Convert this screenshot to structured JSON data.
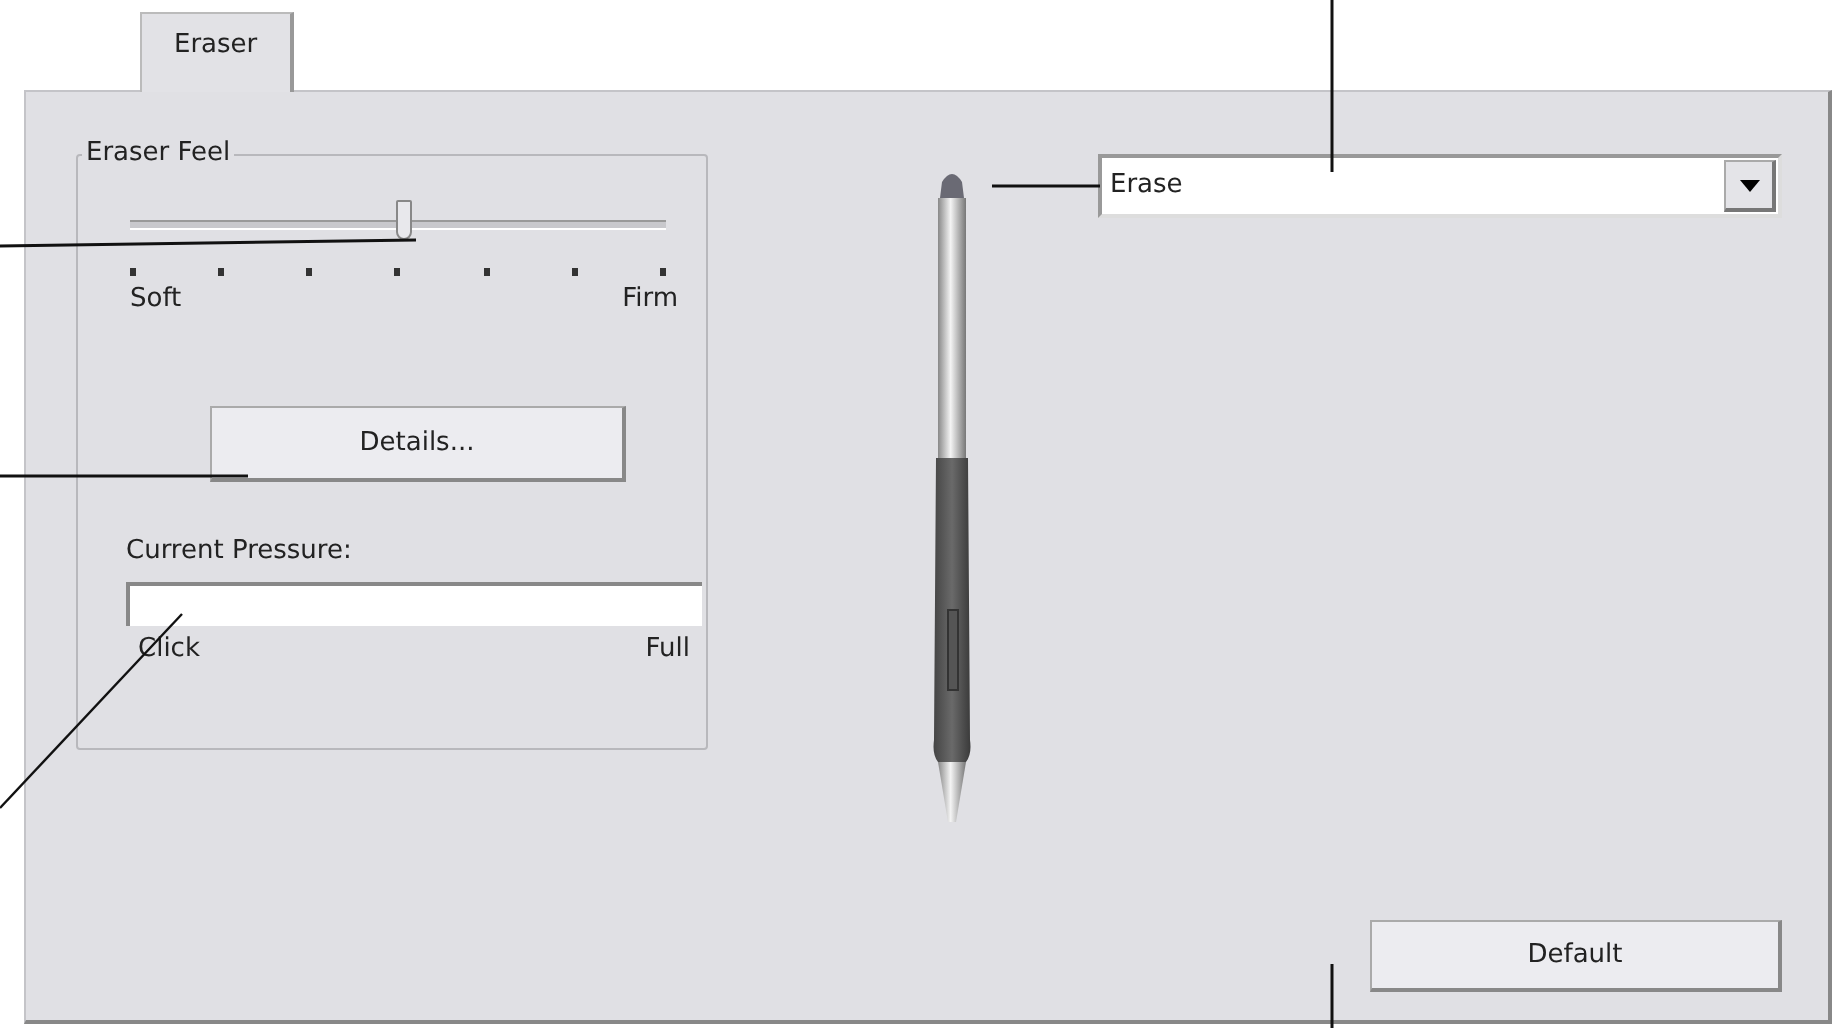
{
  "tabs": [
    {
      "label": "Eraser",
      "selected": true
    }
  ],
  "eraser_feel": {
    "title": "Eraser Feel",
    "level": 0.51,
    "min_label": "Soft",
    "max_label": "Firm",
    "details_button": "Details..."
  },
  "current_pressure": {
    "label": "Current Pressure:",
    "min_label": "Click",
    "max_label": "Full"
  },
  "eraser_function": {
    "value": "Erase"
  },
  "buttons": [
    "Default"
  ]
}
